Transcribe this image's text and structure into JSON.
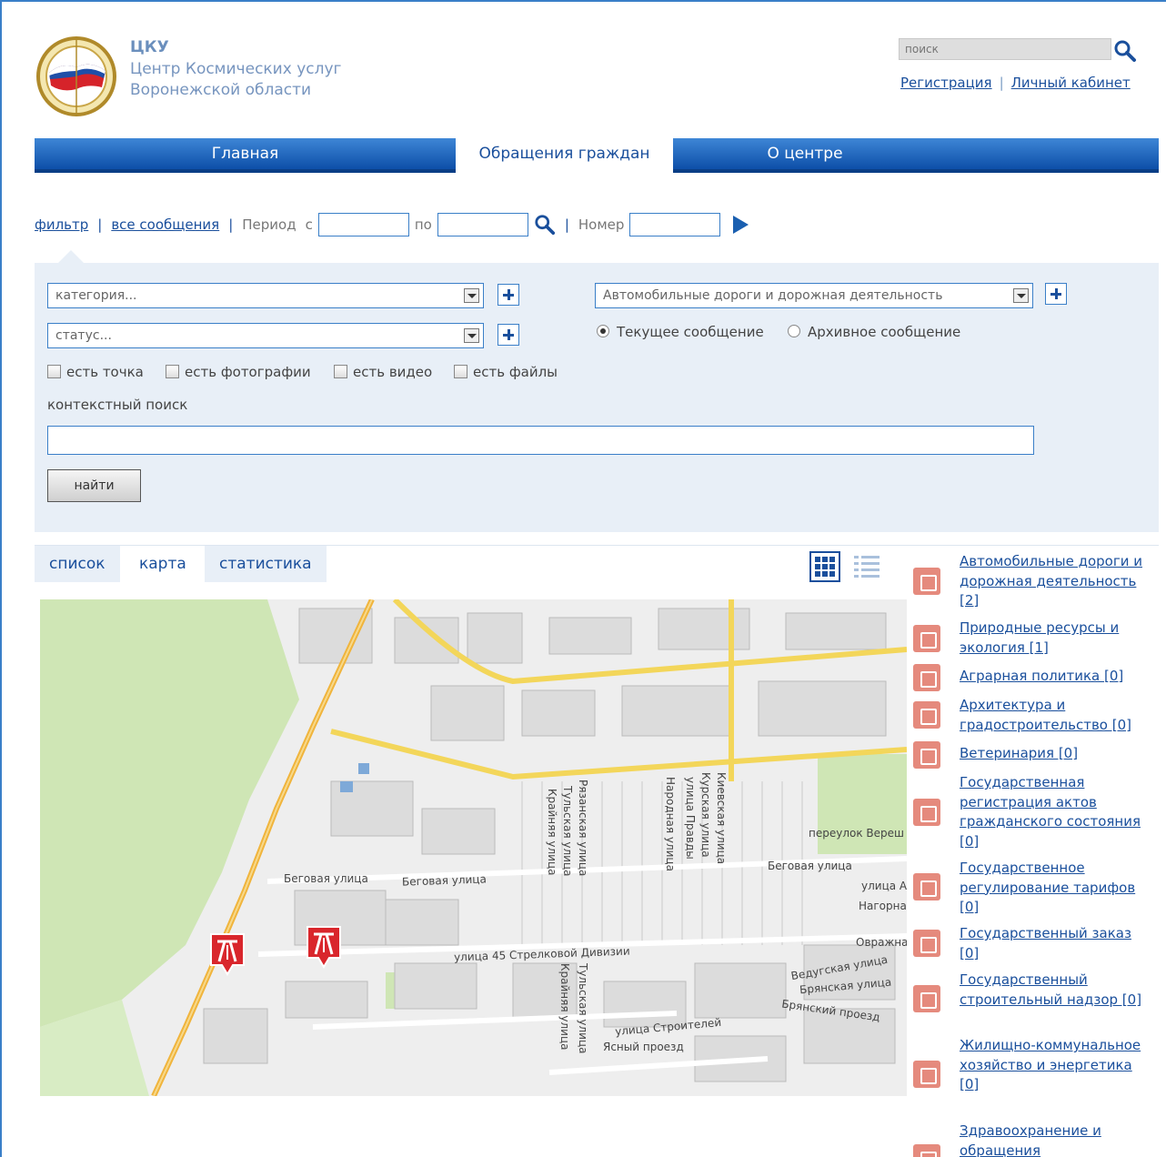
{
  "header": {
    "org_short": "ЦКУ",
    "org_line1": "Центр Космических услуг",
    "org_line2": "Воронежской области",
    "search_placeholder": "поиск",
    "register_label": "Регистрация",
    "cabinet_label": "Личный кабинет",
    "separator": "|"
  },
  "nav": {
    "items": [
      {
        "label": "Главная"
      },
      {
        "label": "Обращения граждан"
      },
      {
        "label": "О центре"
      }
    ],
    "active_index": 1
  },
  "filter_bar": {
    "filter_label": "фильтр",
    "all_messages_label": "все сообщения",
    "separator": "|",
    "period_label": "Период",
    "from_label": "с",
    "to_label": "по",
    "number_label": "Номер"
  },
  "panel": {
    "category_select": "категория...",
    "status_select": "статус...",
    "domain_select": "Автомобильные дороги и дорожная деятельность",
    "radio_current": "Текущее сообщение",
    "radio_archive": "Архивное сообщение",
    "checkboxes": [
      "есть точка",
      "есть фотографии",
      "есть видео",
      "есть файлы"
    ],
    "context_search_label": "контекстный поиск",
    "find_button": "найти"
  },
  "tabs": [
    {
      "label": "список"
    },
    {
      "label": "карта"
    },
    {
      "label": "статистика"
    }
  ],
  "active_tab_index": 1,
  "map": {
    "streets": [
      "Беговая улица",
      "Беговая улица",
      "Беговая улица",
      "улица 45 Стрелковой Дивизии",
      "улица Строителей",
      "Ясный проезд",
      "Ведугская улица",
      "Брянская улица",
      "Брянский проезд",
      "переулок Вереш",
      "улица А",
      "Нагорна",
      "Овражна",
      "Рязанская улица",
      "Тульская улица",
      "Крайняя улица",
      "Народная улица",
      "улица Правды",
      "Курская улица",
      "Киевская улица",
      "Тульская улица",
      "Крайняя улица"
    ],
    "marker_icon": "road-sign-icon"
  },
  "categories": [
    {
      "label": "Автомобильные дороги и дорожная деятельность [2]",
      "icon": "road-icon"
    },
    {
      "label": "Природные ресурсы и экология [1]",
      "icon": "nature-icon"
    },
    {
      "label": "Аграрная политика [0]",
      "icon": "agriculture-icon"
    },
    {
      "label": "Архитектура и градостроительство [0]",
      "icon": "architecture-icon"
    },
    {
      "label": "Ветеринария [0]",
      "icon": "veterinary-icon"
    },
    {
      "label": "Государственная регистрация актов гражданского состояния [0]",
      "icon": "registry-icon"
    },
    {
      "label": "Государственное регулирование тарифов [0]",
      "icon": "tariff-icon"
    },
    {
      "label": "Государственный заказ [0]",
      "icon": "gov-order-icon"
    },
    {
      "label": "Государственный строительный надзор [0]",
      "icon": "construction-icon"
    },
    {
      "label": "Жилищно-коммунальное хозяйство и энергетика [0]",
      "icon": "housing-icon"
    },
    {
      "label": "Здравоохранение и обращения",
      "icon": "health-icon"
    }
  ],
  "colors": {
    "accent": "#1a4f9c",
    "nav_top": "#3e86d6",
    "nav_bottom": "#0d4fa8",
    "panel_bg": "#e8eff7",
    "marker_red": "#d9262c",
    "category_icon": "#e58a7d",
    "map_road_yellow": "#f3d65a"
  }
}
